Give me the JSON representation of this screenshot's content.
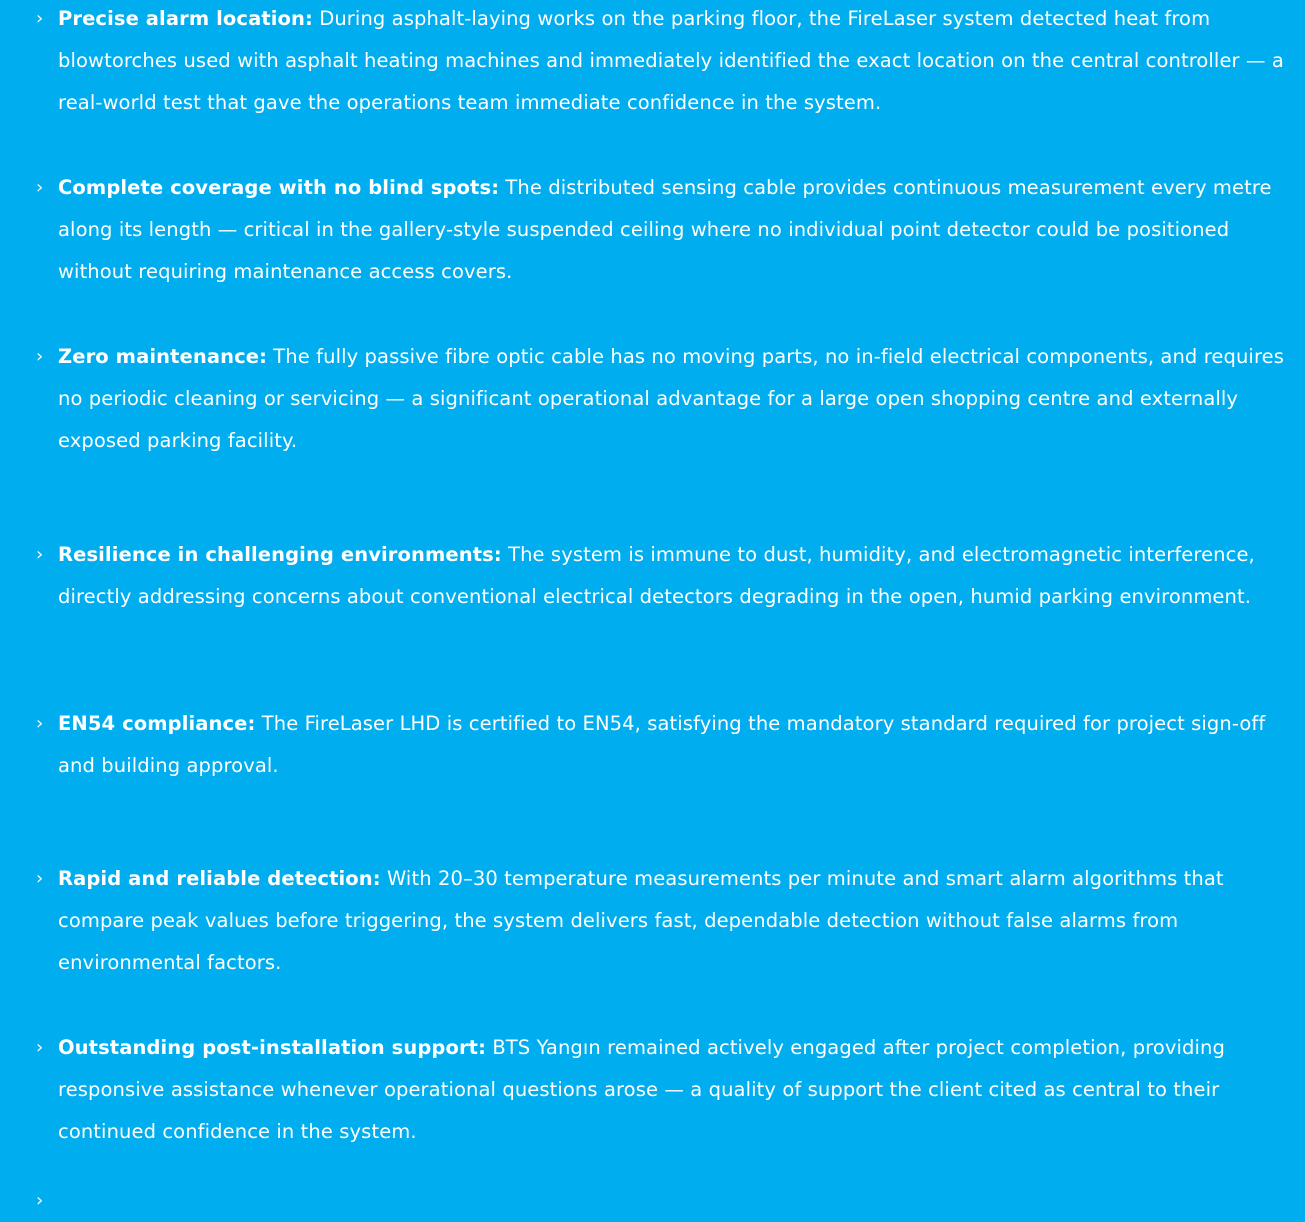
{
  "bullet_glyph": "›",
  "separator": ":",
  "benefits": [
    {
      "title": "Precise alarm location",
      "text": "During asphalt-laying works on the parking floor, the FireLaser system detected heat from blowtorches used with asphalt heating machines and immediately identified the exact location on the central controller — a real-world test that gave the operations team immediate confidence in the system."
    },
    {
      "title": "Complete coverage with no blind spots",
      "text": "The distributed sensing cable provides continuous measurement every metre along its length — critical in the gallery-style suspended ceiling where no individual point detector could be positioned without requiring maintenance access covers."
    },
    {
      "title": "Zero maintenance",
      "text": "The fully passive fibre optic cable has no moving parts, no in-field electrical components, and requires no periodic cleaning or servicing — a significant operational advantage for a large open shopping centre and externally exposed parking facility."
    },
    {
      "title": "Resilience in challenging environments",
      "text": "The system is immune to dust, humidity, and electromagnetic interference, directly addressing concerns about conventional electrical detectors degrading in the open, humid parking environment."
    },
    {
      "title": "EN54 compliance",
      "text": "The FireLaser LHD is certified to EN54, satisfying the mandatory standard required for project sign-off and building approval."
    },
    {
      "title": "Rapid and reliable detection",
      "text": "With 20–30 temperature measurements per minute and smart alarm algorithms that compare peak values before triggering, the system delivers fast, dependable detection without false alarms from environmental factors."
    },
    {
      "title": "Outstanding post-installation support",
      "text": "BTS Yangın remained actively engaged after project completion, providing responsive assistance whenever operational questions arose — a quality of support the client cited as central to their continued confidence in the system."
    }
  ]
}
